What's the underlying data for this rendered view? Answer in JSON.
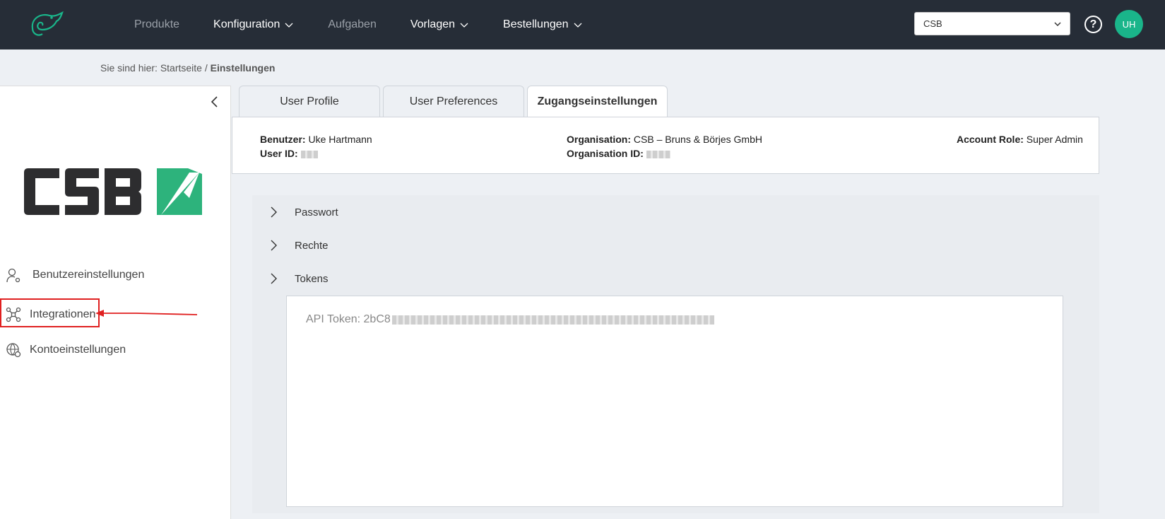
{
  "nav": {
    "items": [
      {
        "label": "Produkte",
        "dropdown": false,
        "muted": true
      },
      {
        "label": "Konfiguration",
        "dropdown": true,
        "muted": false
      },
      {
        "label": "Aufgaben",
        "dropdown": false,
        "muted": true
      },
      {
        "label": "Vorlagen",
        "dropdown": true,
        "muted": false
      },
      {
        "label": "Bestellungen",
        "dropdown": true,
        "muted": false
      }
    ],
    "org_select": "CSB",
    "help_label": "?",
    "avatar_initials": "UH"
  },
  "breadcrumb": {
    "prefix": "Sie sind hier: Startseite /",
    "current": "Einstellungen"
  },
  "sidebar": {
    "items": [
      {
        "label": "Benutzereinstellungen",
        "icon": "user-settings-icon"
      },
      {
        "label": "Integrationen",
        "icon": "integration-icon"
      },
      {
        "label": "Kontoeinstellungen",
        "icon": "account-settings-icon"
      }
    ]
  },
  "tabs": [
    {
      "label": "User Profile",
      "active": false
    },
    {
      "label": "User Preferences",
      "active": false
    },
    {
      "label": "Zugangseinstellungen",
      "active": true
    }
  ],
  "info": {
    "benutzer_label": "Benutzer:",
    "benutzer_value": "Uke Hartmann",
    "userid_label": "User ID:",
    "org_label": "Organisation:",
    "org_value": "CSB – Bruns & Börjes GmbH",
    "orgid_label": "Organisation ID:",
    "role_label": "Account Role:",
    "role_value": "Super Admin"
  },
  "accordion": [
    {
      "label": "Passwort"
    },
    {
      "label": "Rechte"
    },
    {
      "label": "Tokens"
    }
  ],
  "token": {
    "prefix": "API Token: 2bC8"
  },
  "colors": {
    "topbar": "#262d37",
    "accent": "#1ab58a",
    "highlight": "#e02020"
  }
}
